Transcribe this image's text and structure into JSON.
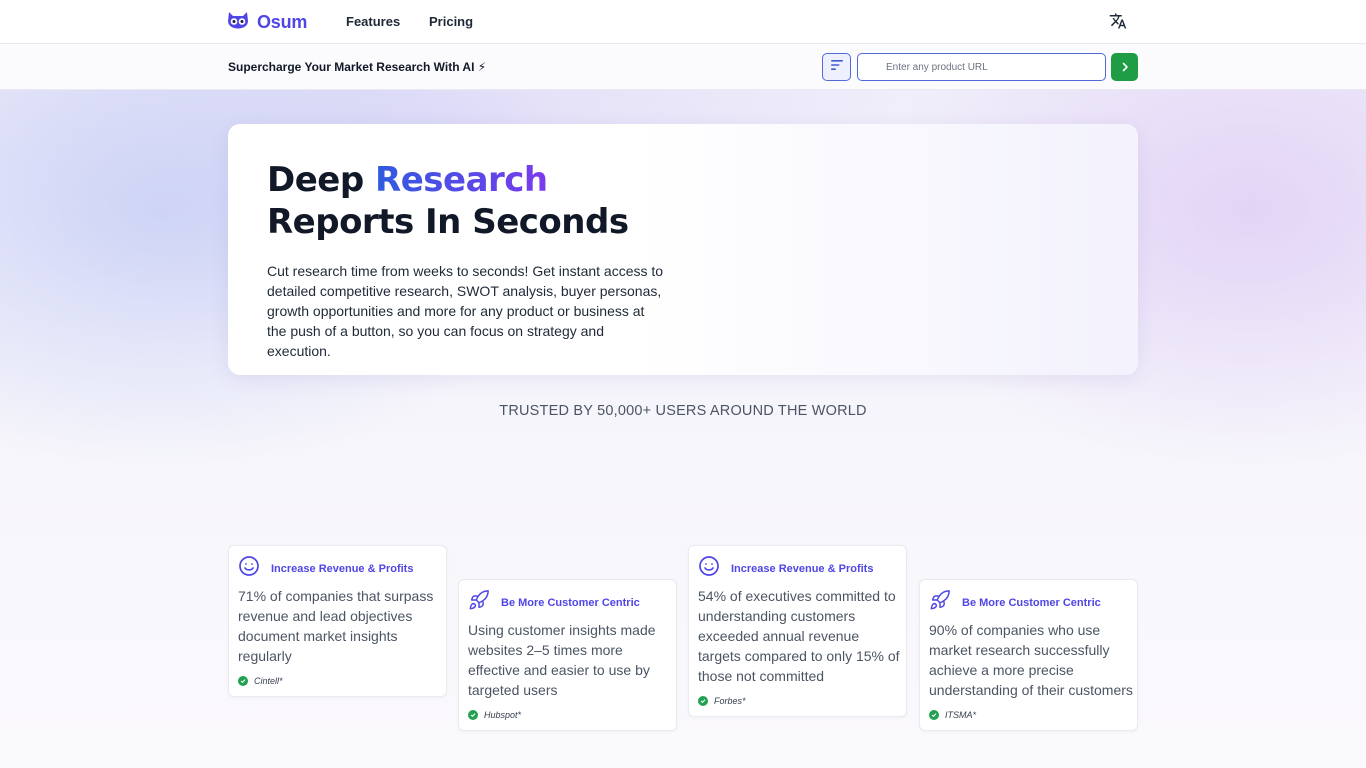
{
  "nav": {
    "brand": "Osum",
    "links": [
      "Features",
      "Pricing"
    ],
    "language_icon": "translate-icon"
  },
  "subbar": {
    "tagline": "Supercharge Your Market Research With AI ⚡",
    "url_placeholder": "Enter any product URL",
    "filter_icon": "filter-lines-icon",
    "submit_icon": "chevron-right-icon"
  },
  "hero": {
    "title_part1": "Deep ",
    "title_accent": "Research",
    "title_line2": "Reports In Seconds",
    "description": "Cut research time from weeks to seconds! Get instant access to detailed competitive research, SWOT analysis, buyer personas, growth opportunities and more for any product or business at the push of a button, so you can focus on strategy and execution."
  },
  "trusted": "TRUSTED BY 50,000+ USERS AROUND THE WORLD",
  "cards": [
    {
      "icon": "smile-icon",
      "category": "Increase Revenue & Profits",
      "text": "71% of companies that surpass revenue and lead objectives document market insights regularly",
      "source": "Cintell*"
    },
    {
      "icon": "rocket-icon",
      "category": "Be More Customer Centric",
      "text": "Using customer insights made websites 2–5 times more effective and easier to use by targeted users",
      "source": "Hubspot*"
    },
    {
      "icon": "smile-icon",
      "category": "Increase Revenue & Profits",
      "text": "54% of executives committed to understanding customers exceeded annual revenue targets compared to only 15% of those not committed",
      "source": "Forbes*"
    },
    {
      "icon": "rocket-icon",
      "category": "Be More Customer Centric",
      "text": "90% of companies who use market research successfully achieve a more precise understanding of their customers",
      "source": "ITSMA*"
    }
  ],
  "colors": {
    "brand": "#4f46e5",
    "submit": "#1f9d45",
    "check": "#22a152"
  }
}
